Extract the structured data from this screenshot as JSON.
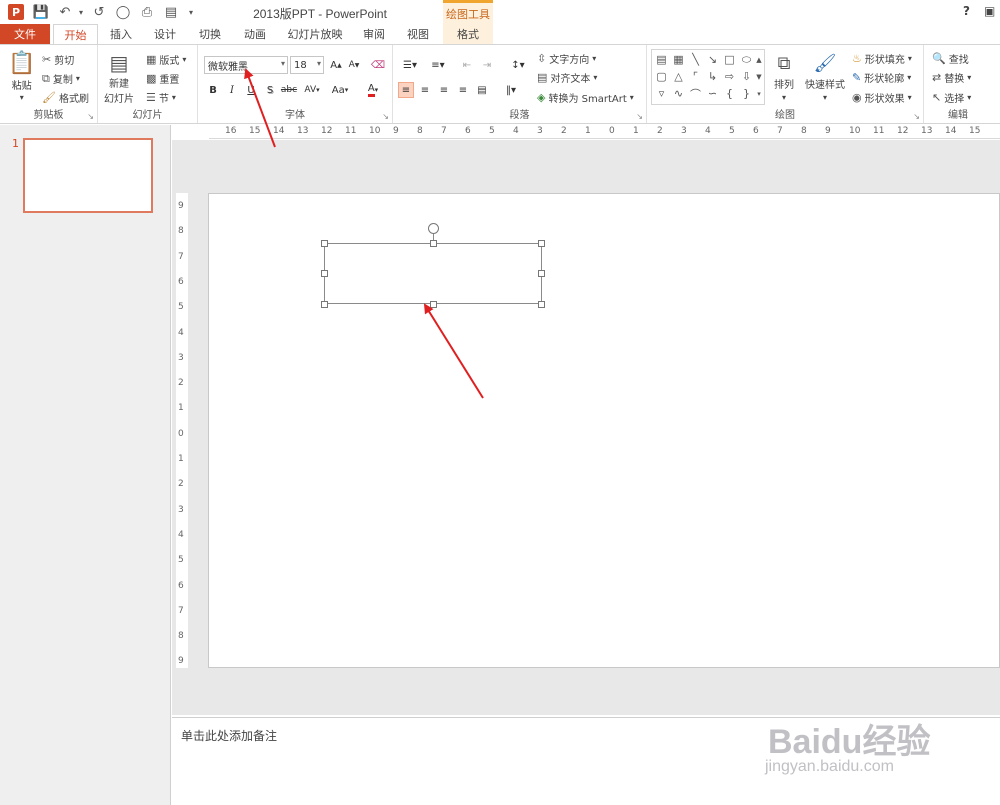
{
  "window": {
    "title": "2013版PPT - PowerPoint",
    "contextual_tool": "绘图工具",
    "help": "?",
    "app_icon": "P"
  },
  "tabs": [
    "文件",
    "开始",
    "插入",
    "设计",
    "切换",
    "动画",
    "幻灯片放映",
    "审阅",
    "视图",
    "格式"
  ],
  "ribbon": {
    "clipboard": {
      "paste": "粘贴",
      "cut": "剪切",
      "copy": "复制",
      "format_painter": "格式刷",
      "label": "剪贴板"
    },
    "slides": {
      "new_slide_line1": "新建",
      "new_slide_line2": "幻灯片",
      "layout": "版式",
      "reset": "重置",
      "section": "节",
      "label": "幻灯片"
    },
    "font": {
      "family": "微软雅黑",
      "size": "18",
      "bold": "B",
      "italic": "I",
      "underline": "U",
      "shadow": "S",
      "spacing": "AV",
      "case": "Aa",
      "color": "A",
      "grow": "A",
      "shrink": "A",
      "label": "字体"
    },
    "paragraph": {
      "text_direction": "文字方向",
      "align_text": "对齐文本",
      "smartart": "转换为 SmartArt",
      "label": "段落"
    },
    "drawing": {
      "arrange": "排列",
      "quick_styles": "快速样式",
      "shape_fill": "形状填充",
      "shape_outline": "形状轮廓",
      "shape_effects": "形状效果",
      "label": "绘图"
    },
    "editing": {
      "find": "查找",
      "replace": "替换",
      "select": "选择",
      "label": "编辑"
    }
  },
  "ruler": {
    "horizontal": [
      "16",
      "15",
      "14",
      "13",
      "12",
      "11",
      "10",
      "9",
      "8",
      "7",
      "6",
      "5",
      "4",
      "3",
      "2",
      "1",
      "0",
      "1",
      "2",
      "3",
      "4",
      "5",
      "6",
      "7",
      "8",
      "9",
      "10",
      "11",
      "12",
      "13",
      "14",
      "15"
    ],
    "vertical": [
      "9",
      "8",
      "7",
      "6",
      "5",
      "4",
      "3",
      "2",
      "1",
      "0",
      "1",
      "2",
      "3",
      "4",
      "5",
      "6",
      "7",
      "8",
      "9"
    ]
  },
  "thumbnails": {
    "slide_number": "1"
  },
  "notes": {
    "placeholder": "单击此处添加备注"
  },
  "watermark": {
    "logo": "Baidu经验",
    "url": "jingyan.baidu.com"
  },
  "colors": {
    "accent": "#d24726",
    "context_tab": "#fdf0dc",
    "annotation_arrow": "#e02020"
  }
}
